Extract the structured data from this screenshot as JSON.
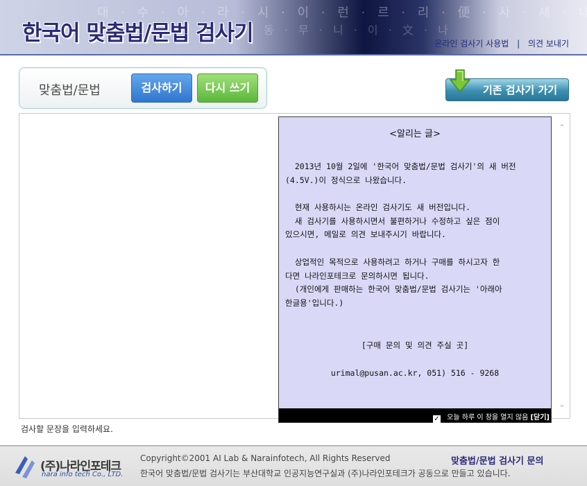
{
  "header": {
    "title": "한국어 맞춤법/문법 검사기",
    "links": [
      "온라인 검사기 사용법",
      "의견 보내기"
    ],
    "separator": "|",
    "bg_text_1": "대 · 수 · 아 · 라 · 시 · 이 · 런 · 르 · 리 · 便 · 사 · 새 · 내",
    "bg_text_2": "동 · 무 · 니 · 이 · 文 · 나"
  },
  "toolbar": {
    "mode_label": "맞춤법/문법",
    "check_label": "검사하기",
    "rewrite_label": "다시 쓰기"
  },
  "old_checker_label": "기존 검사기 가기",
  "editor": {
    "value": "",
    "hint": "검사할 문장을 입력하세요.",
    "scroll_up": "⌃",
    "scroll_down": "⌄"
  },
  "notice": {
    "title": "<알리는 글>",
    "paragraphs": [
      "  2013년 10월 2일에 '한국어 맞춤법/문법 검사기'의 새 버전\n(4.5V.)이 정식으로 나왔습니다.",
      "  현재 사용하시는 온라인 검사기도 새 버전입니다.\n  새 검사기를 사용하시면서 불편하거나 수정하고 싶은 점이\n있으시면, 메일로 의견 보내주시기 바랍니다.",
      "  상업적인 목적으로 사용하려고 하거나 구매를 하시고자 한\n다면 나라인포테크로 문의하시면 됩니다.\n  (개인에게 판매하는 한국어 맞춤법/문법 검사기는 '아래아\n한글용'입니다.)"
    ],
    "contact_title": "[구매 문의 및 의견 주실 곳]",
    "contact_info": "urimal@pusan.ac.kr, 051) 516 - 9268",
    "dismiss_check": "✓",
    "dismiss_text": "오늘 하루 이 창을 열지 않음",
    "close_label": "[닫기]"
  },
  "footer": {
    "logo_name": "(주)나라인포테크",
    "logo_sub": "nara info tech Co., LTD.",
    "copyright": "Copyright©2001 AI Lab & Narainfotech, All Rights Reserved",
    "credit": "한국어 맞춤법/문법 검사기는 부산대학교 인공지능연구실과 (주)나라인포테크가 공동으로 만들고 있습니다.",
    "inquiry": "맞춤법/문법 검사기 문의"
  },
  "colors": {
    "title": "#2b2a78",
    "check_button": "#2f76cf",
    "rewrite_button": "#5bb83a",
    "notice_bg": "#d9d9f7"
  }
}
